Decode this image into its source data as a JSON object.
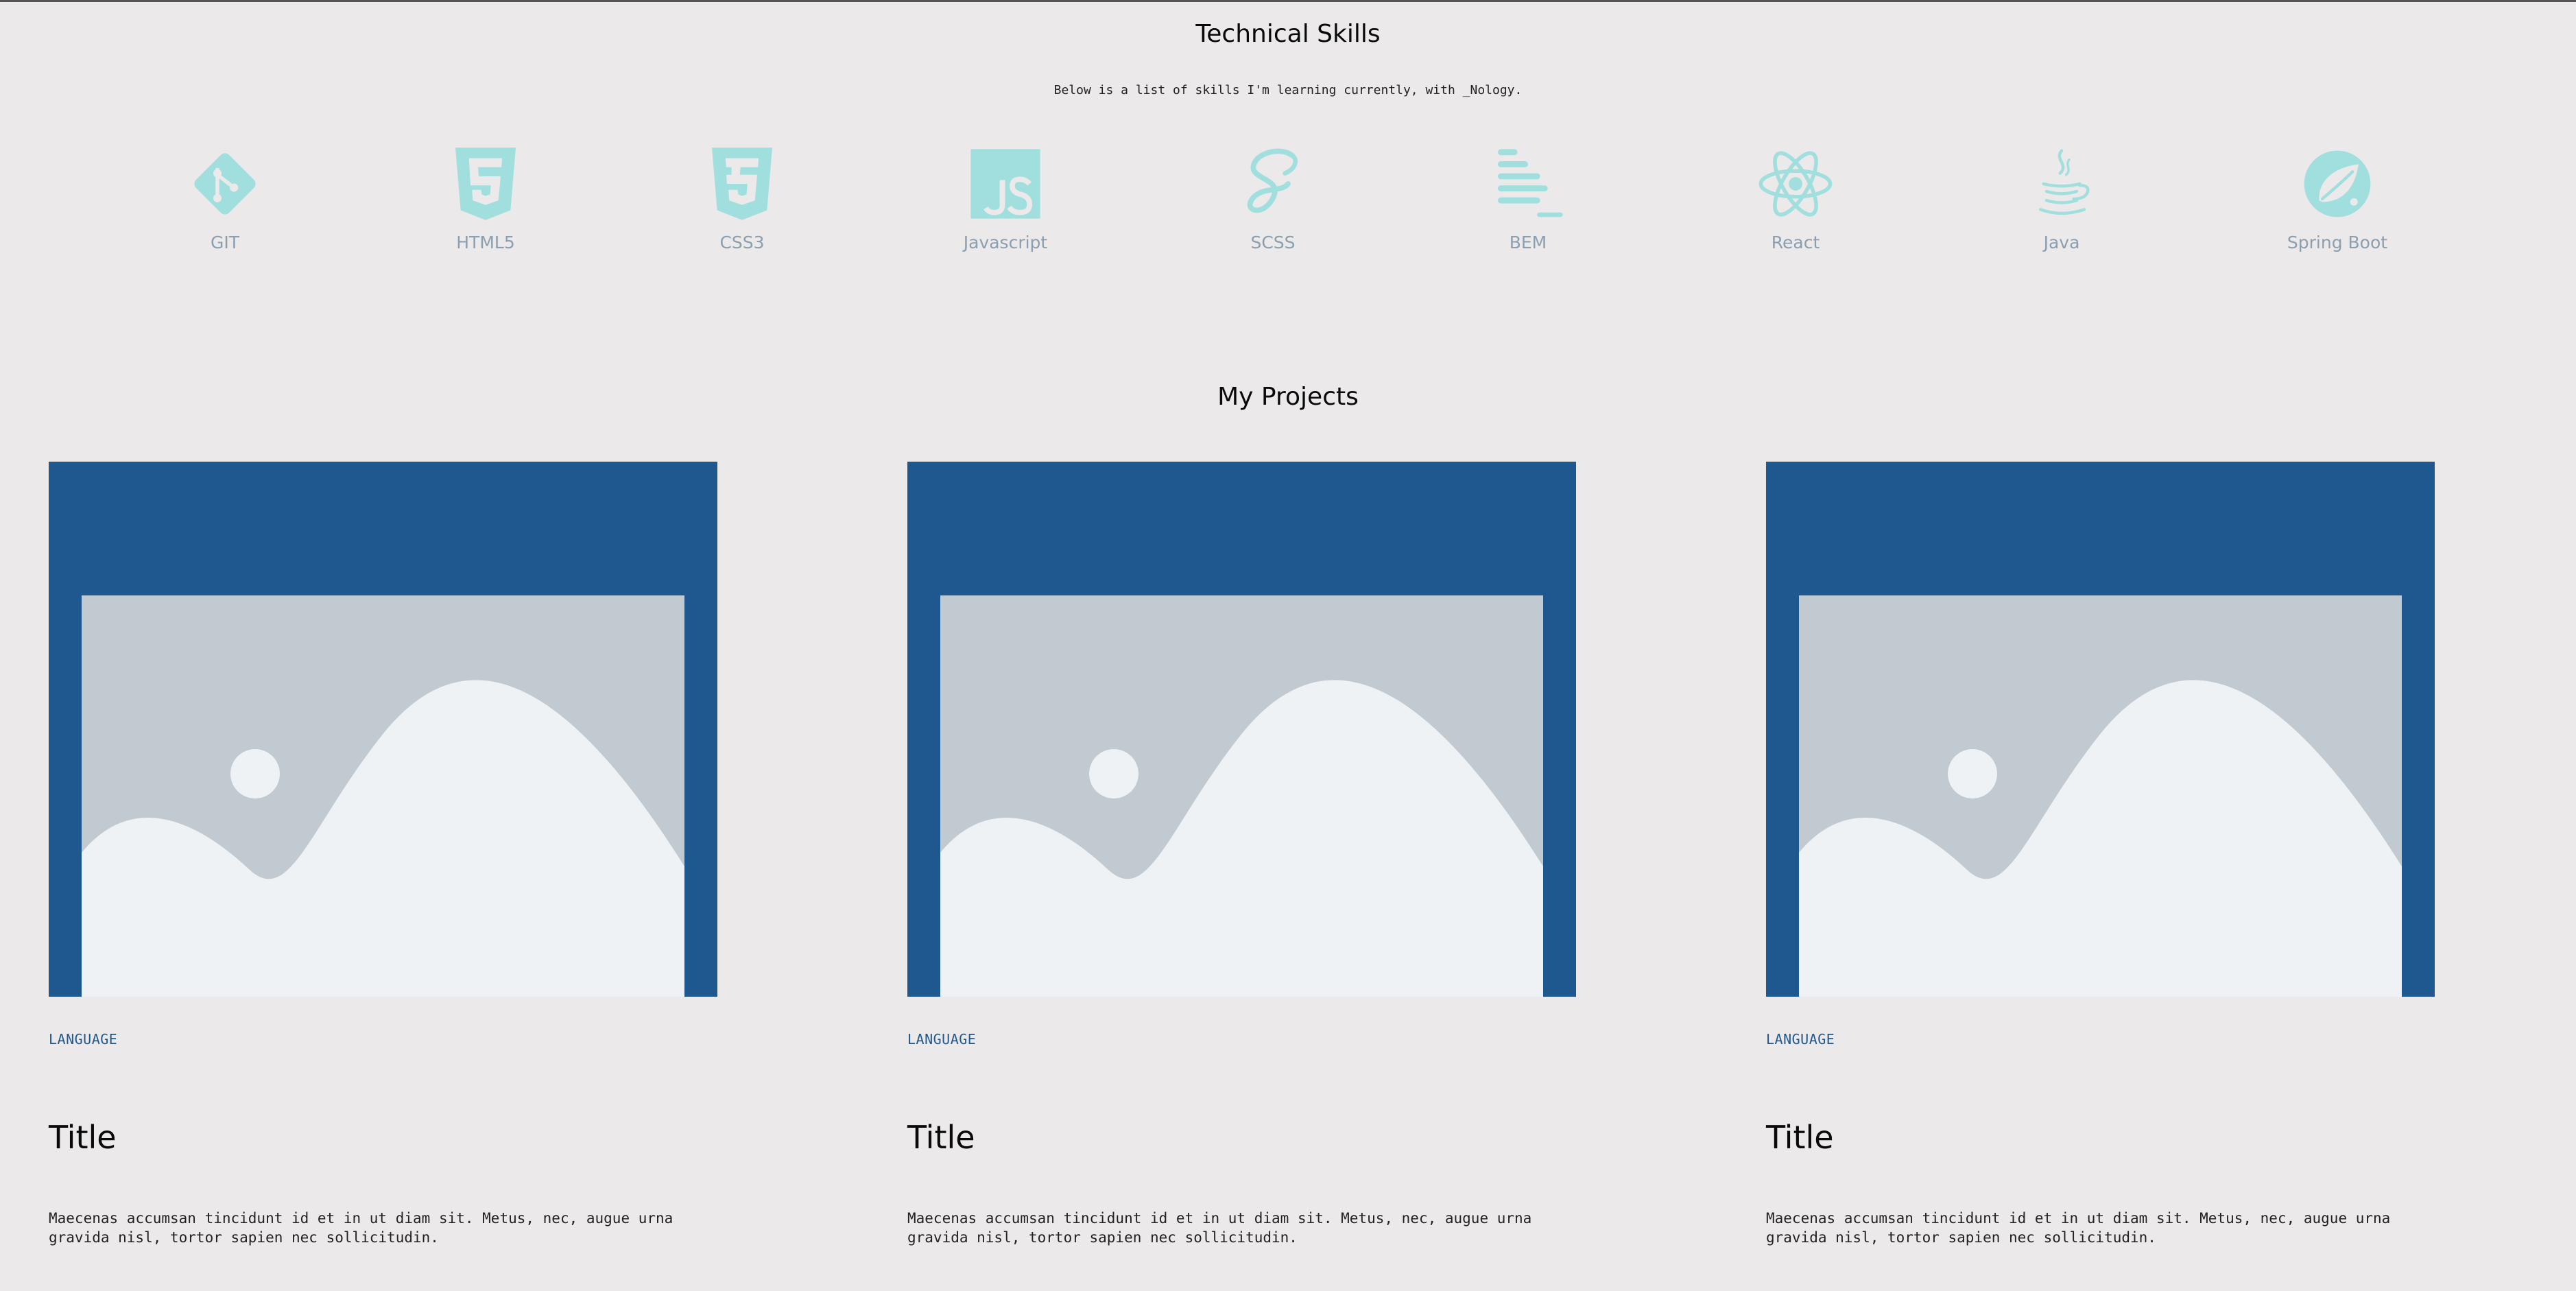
{
  "skills_section": {
    "title": "Technical Skills",
    "subtitle": "Below is a list of skills I'm learning currently, with _Nology.",
    "icon_color": "#a0dfdd",
    "skills": [
      {
        "label": "GIT",
        "icon": "git-icon"
      },
      {
        "label": "HTML5",
        "icon": "html5-icon"
      },
      {
        "label": "CSS3",
        "icon": "css3-icon"
      },
      {
        "label": "Javascript",
        "icon": "javascript-icon"
      },
      {
        "label": "SCSS",
        "icon": "sass-icon"
      },
      {
        "label": "BEM",
        "icon": "bem-icon"
      },
      {
        "label": "React",
        "icon": "react-icon"
      },
      {
        "label": "Java",
        "icon": "java-icon"
      },
      {
        "label": "Spring Boot",
        "icon": "spring-boot-icon"
      }
    ]
  },
  "projects_section": {
    "title": "My Projects",
    "thumb_color": "#1f588e",
    "projects": [
      {
        "language": "LANGUAGE",
        "title": "Title",
        "description_line1": "Maecenas accumsan tincidunt id et in ut diam sit. Metus, nec, augue urna",
        "description_line2": "gravida nisl, tortor sapien nec sollicitudin."
      },
      {
        "language": "LANGUAGE",
        "title": "Title",
        "description_line1": "Maecenas accumsan tincidunt id et in ut diam sit. Metus, nec, augue urna",
        "description_line2": "gravida nisl, tortor sapien nec sollicitudin."
      },
      {
        "language": "LANGUAGE",
        "title": "Title",
        "description_line1": "Maecenas accumsan tincidunt id et in ut diam sit. Metus, nec, augue urna",
        "description_line2": "gravida nisl, tortor sapien nec sollicitudin."
      }
    ]
  }
}
